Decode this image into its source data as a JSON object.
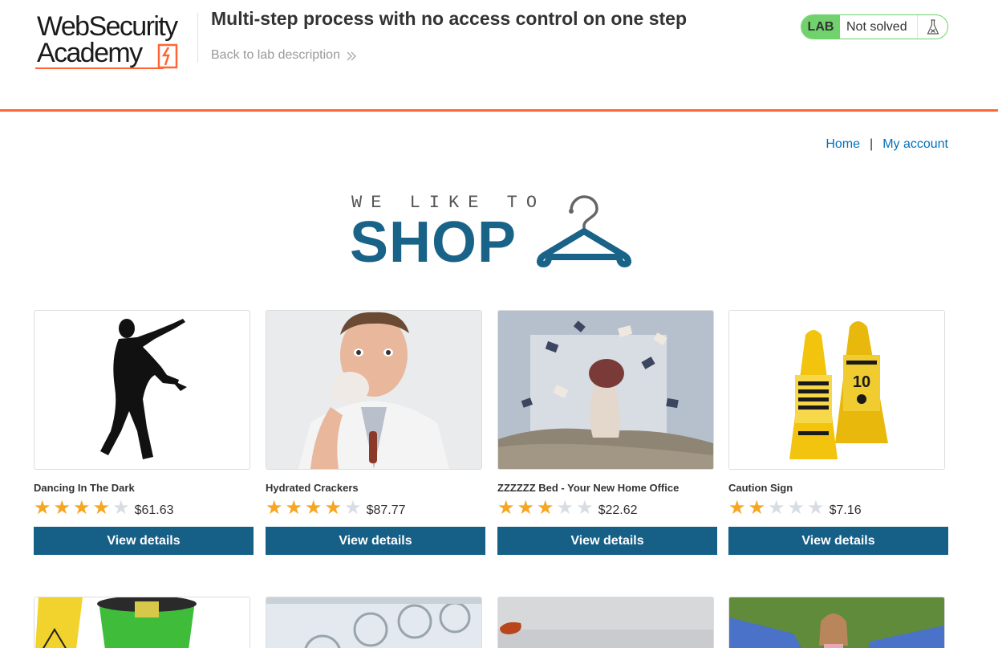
{
  "lab": {
    "logo_line1": "WebSecurity",
    "logo_line2": "Academy",
    "title": "Multi-step process with no access control on one step",
    "back_link": "Back to lab description",
    "badge": "LAB",
    "status": "Not solved"
  },
  "nav": {
    "home": "Home",
    "separator": "|",
    "account": "My account"
  },
  "banner": {
    "tagline": "WE LIKE TO",
    "word": "SHOP"
  },
  "products": [
    {
      "name": "Dancing In The Dark",
      "rating": 4,
      "price": "$61.63",
      "button": "View details"
    },
    {
      "name": "Hydrated Crackers",
      "rating": 4,
      "price": "$87.77",
      "button": "View details"
    },
    {
      "name": "ZZZZZZ Bed - Your New Home Office",
      "rating": 3,
      "price": "$22.62",
      "button": "View details"
    },
    {
      "name": "Caution Sign",
      "rating": 2,
      "price": "$7.16",
      "button": "View details"
    }
  ],
  "colors": {
    "accent": "#ff6633",
    "solved_green": "#70d16d",
    "button_blue": "#165f87",
    "link_blue": "#0071bc",
    "star": "#f5a623"
  }
}
